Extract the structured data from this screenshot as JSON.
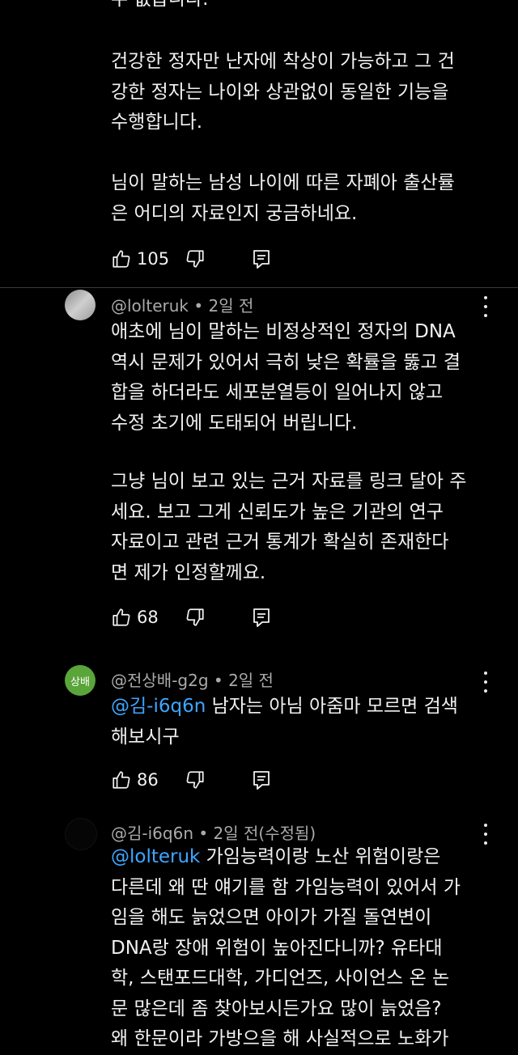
{
  "comment0": {
    "partial_line": "수 없습니다.",
    "paragraph1": "건강한 정자만 난자에 착상이 가능하고 그 건\n강한 정자는 나이와 상관없이 동일한 기능을\n수행합니다.",
    "paragraph2": "님이 말하는 남성 나이에 따른 자폐아 출산률\n은 어디의 자료인지 궁금하네요.",
    "likes": "105"
  },
  "comment1": {
    "author": "@lolteruk",
    "time": "2일 전",
    "paragraph1": "애초에 님이 말하는 비정상적인 정자의 DNA\n역시 문제가 있어서 극히 낮은 확률을 뚫고 결\n합을 하더라도 세포분열등이 일어나지 않고\n수정 초기에 도태되어 버립니다.",
    "paragraph2": "그냥 님이 보고 있는 근거 자료를 링크 달아 주\n세요. 보고 그게 신뢰도가 높은 기관의 연구\n자료이고 관련 근거 통계가 확실히 존재한다\n면 제가 인정할께요.",
    "likes": "68"
  },
  "comment2": {
    "avatar_text": "상배",
    "avatar_color": "#5aa53a",
    "author": "@전상배-g2g",
    "time": "2일 전",
    "mention": "@김-i6q6n",
    "line1_rest": " 남자는 아님 아줌마 모르면 검색",
    "line2": "해보시구",
    "likes": "86"
  },
  "comment3": {
    "author": "@김-i6q6n",
    "time": "2일 전(수정됨)",
    "mention": "@lolteruk",
    "line1_rest": " 가임능력이랑 노산 위험이랑은",
    "rest": "다른데 왜 딴 얘기를 함 가임능력이 있어서 가\n임을 해도 늙었으면 아이가 가질 돌연변이\nDNA랑 장애 위험이 높아진다니까? 유타대\n학, 스탠포드대학, 가디언즈, 사이언스 온 논\n문 많은데 좀 찾아보시든가요 많이 늙었음?\n왜 한문이라 가방으을 해 사실적으로 노화가"
  },
  "colors": {
    "background": "#000000",
    "text": "#f1f1f1",
    "meta": "#aaaaaa",
    "mention": "#3ea6ff"
  },
  "icons": {
    "like": "thumbs-up-icon",
    "dislike": "thumbs-down-icon",
    "reply": "reply-icon",
    "more": "more-vertical-icon"
  }
}
